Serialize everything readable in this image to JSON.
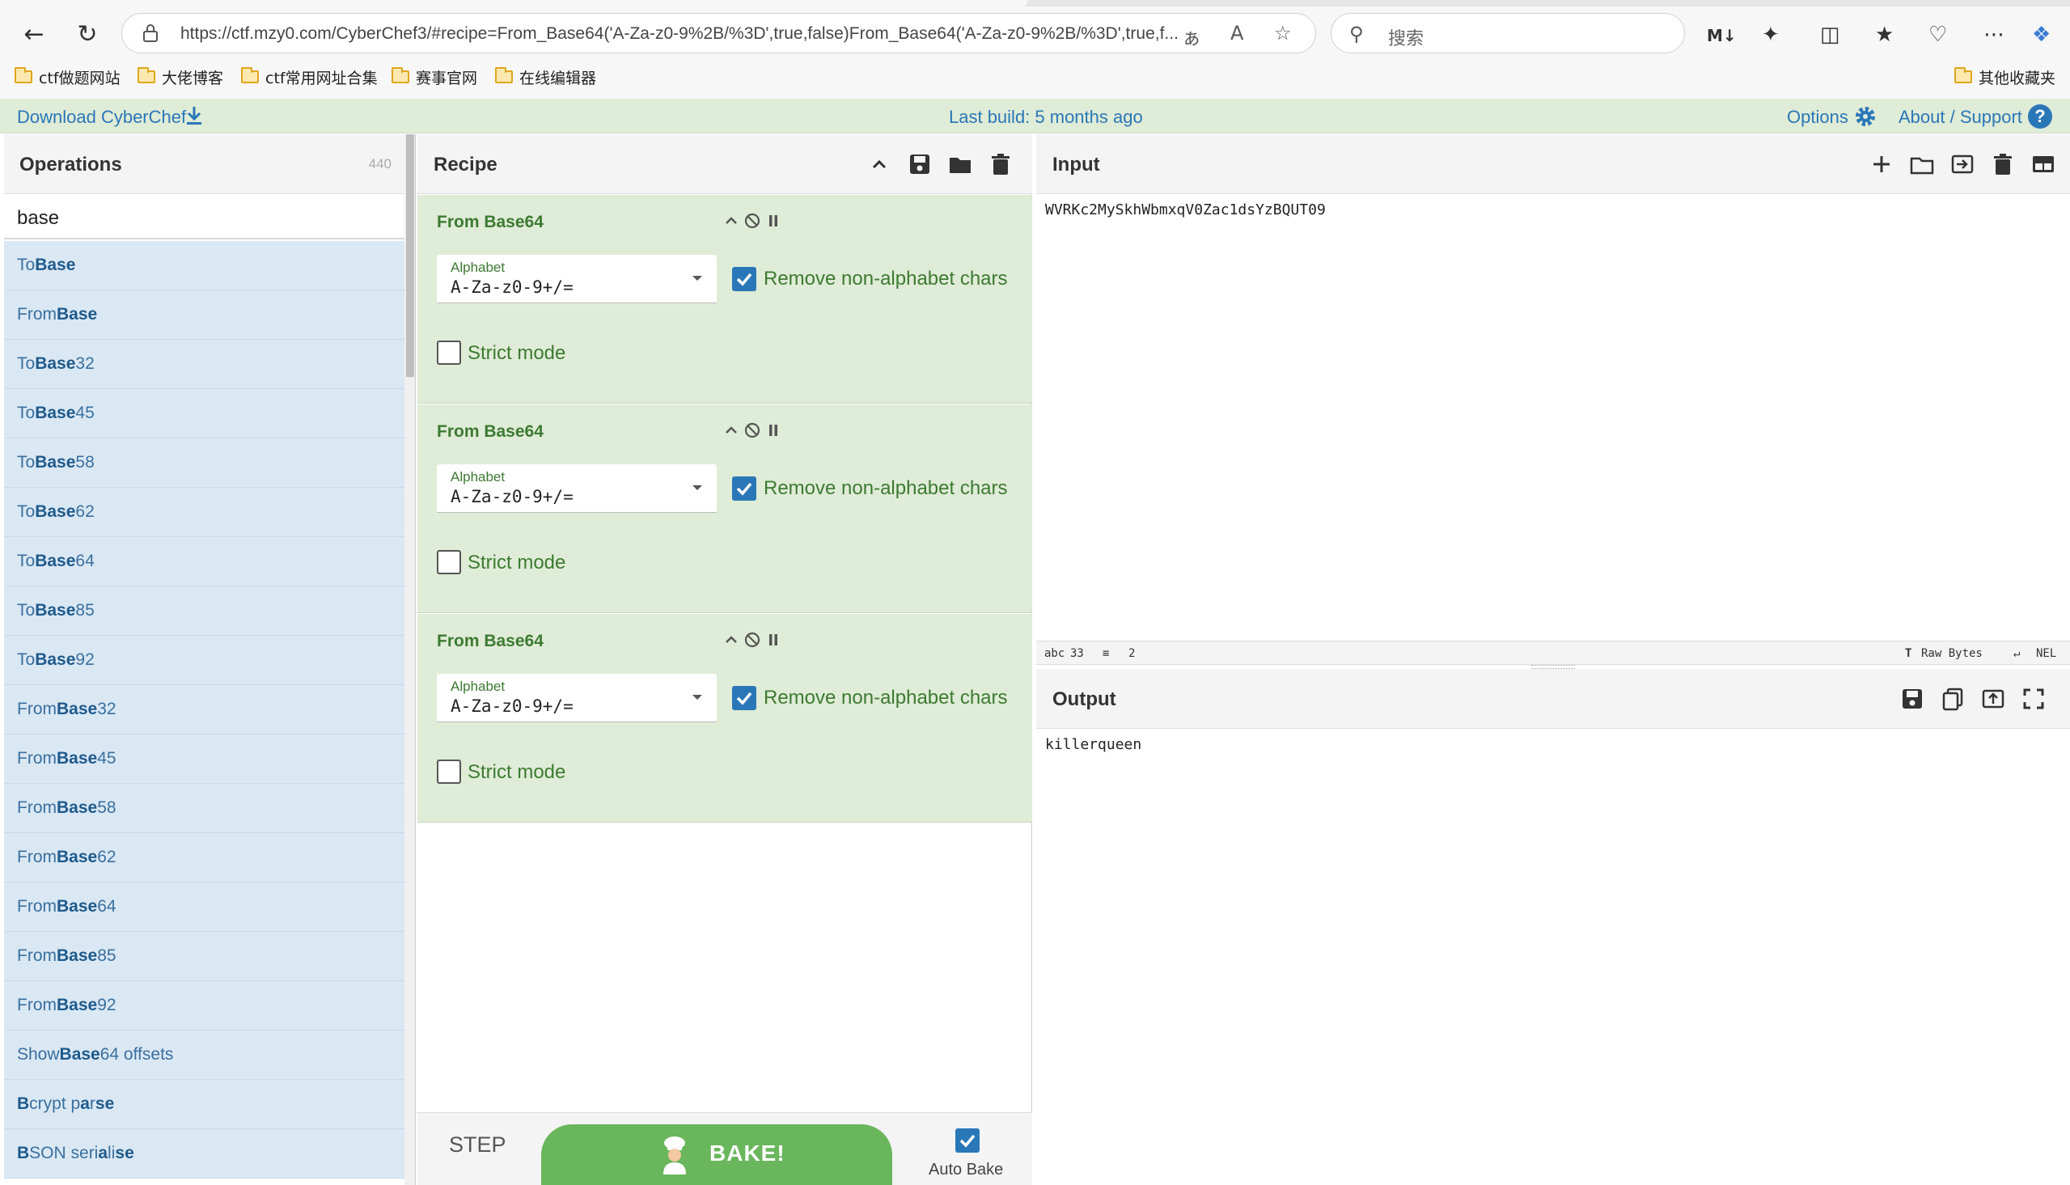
{
  "browser": {
    "url": "https://ctf.mzy0.com/CyberChef3/#recipe=From_Base64('A-Za-z0-9%2B/%3D',true,false)From_Base64('A-Za-z0-9%2B/%3D',true,f...",
    "search_placeholder": "搜索",
    "bookmarks": [
      {
        "label": "ctf做题网站"
      },
      {
        "label": "大佬博客"
      },
      {
        "label": "ctf常用网址合集"
      },
      {
        "label": "赛事官网"
      },
      {
        "label": "在线编辑器"
      }
    ],
    "other_bookmarks": "其他收藏夹"
  },
  "banner": {
    "download": "Download CyberChef",
    "last_build": "Last build: 5 months ago",
    "options": "Options",
    "about": "About / Support",
    "help_glyph": "?"
  },
  "operations": {
    "title": "Operations",
    "count": "440",
    "search_value": "base",
    "items": [
      {
        "pre": "To ",
        "match": "Base",
        "post": ""
      },
      {
        "pre": "From ",
        "match": "Base",
        "post": ""
      },
      {
        "pre": "To ",
        "match": "Base",
        "post": "32"
      },
      {
        "pre": "To ",
        "match": "Base",
        "post": "45"
      },
      {
        "pre": "To ",
        "match": "Base",
        "post": "58"
      },
      {
        "pre": "To ",
        "match": "Base",
        "post": "62"
      },
      {
        "pre": "To ",
        "match": "Base",
        "post": "64"
      },
      {
        "pre": "To ",
        "match": "Base",
        "post": "85"
      },
      {
        "pre": "To ",
        "match": "Base",
        "post": "92"
      },
      {
        "pre": "From ",
        "match": "Base",
        "post": "32"
      },
      {
        "pre": "From ",
        "match": "Base",
        "post": "45"
      },
      {
        "pre": "From ",
        "match": "Base",
        "post": "58"
      },
      {
        "pre": "From ",
        "match": "Base",
        "post": "62"
      },
      {
        "pre": "From ",
        "match": "Base",
        "post": "64"
      },
      {
        "pre": "From ",
        "match": "Base",
        "post": "85"
      },
      {
        "pre": "From ",
        "match": "Base",
        "post": "92"
      },
      {
        "pre": "Show ",
        "match": "Base",
        "post": "64 offsets"
      },
      {
        "pre": "",
        "match": "B",
        "post": "crypt p",
        "match2": "a",
        "post2": "r",
        "match3": "se",
        "post3": ""
      },
      {
        "pre": "",
        "match": "B",
        "post": "SON seri",
        "match2": "a",
        "post2": "li",
        "match3": "se",
        "post3": ""
      }
    ]
  },
  "recipe": {
    "title": "Recipe",
    "ops": [
      {
        "name": "From Base64",
        "alphabet_label": "Alphabet",
        "alphabet": "A-Za-z0-9+/=",
        "remove_label": "Remove non-alphabet chars",
        "remove": true,
        "strict_label": "Strict mode",
        "strict": false
      },
      {
        "name": "From Base64",
        "alphabet_label": "Alphabet",
        "alphabet": "A-Za-z0-9+/=",
        "remove_label": "Remove non-alphabet chars",
        "remove": true,
        "strict_label": "Strict mode",
        "strict": false
      },
      {
        "name": "From Base64",
        "alphabet_label": "Alphabet",
        "alphabet": "A-Za-z0-9+/=",
        "remove_label": "Remove non-alphabet chars",
        "remove": true,
        "strict_label": "Strict mode",
        "strict": false
      }
    ],
    "step": "STEP",
    "bake": "BAKE!",
    "auto_bake_label": "Auto Bake",
    "auto_bake": true
  },
  "input": {
    "title": "Input",
    "text": "WVRKc2MySkhWbmxqV0Zac1dsYzBQUT09",
    "length": "33",
    "lines": "2",
    "raw_bytes": "Raw Bytes",
    "eol": "NEL"
  },
  "output": {
    "title": "Output",
    "text": "killerqueen"
  },
  "colors": {
    "accent": "#2a77b8",
    "recipe_bg": "#dfecd7",
    "ops_bg": "#dae8f4",
    "bake": "#6ab65c"
  }
}
